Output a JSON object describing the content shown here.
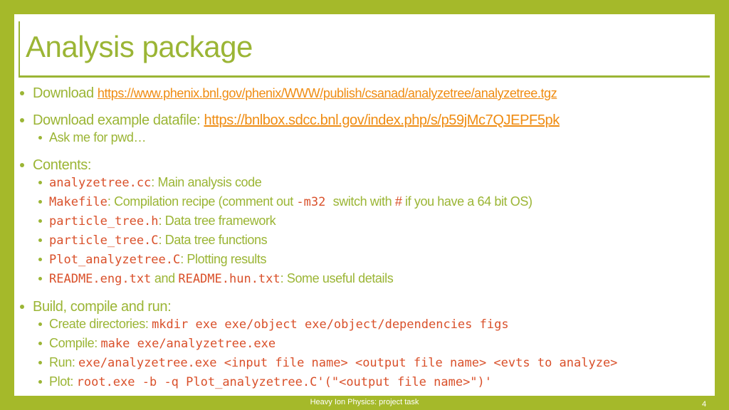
{
  "title": "Analysis package",
  "colors": {
    "frame": "#a5b92a",
    "text": "#9bb535",
    "code": "#d9502a",
    "link": "#ef8c12"
  },
  "lines": [
    {
      "level": 1,
      "top": 0,
      "segments": [
        {
          "t": "Download ",
          "k": "text"
        },
        {
          "t": "https://www.phenix.bnl.gov/phenix/WWW/publish/csanad/analyzetree/analyzetree.tgz",
          "k": "link small"
        }
      ]
    },
    {
      "level": 1,
      "segments": [
        {
          "t": "Download example datafile: ",
          "k": "text"
        },
        {
          "t": "https://bnlbox.sdcc.bnl.gov/index.php/s/p59jMc7QJEPF5pk",
          "k": "link"
        }
      ]
    },
    {
      "level": 2,
      "segments": [
        {
          "t": "Ask me for pwd…",
          "k": "text"
        }
      ]
    },
    {
      "level": 1,
      "segments": [
        {
          "t": "Contents:",
          "k": "text"
        }
      ]
    },
    {
      "level": 2,
      "segments": [
        {
          "t": "analyzetree.cc",
          "k": "code"
        },
        {
          "t": ": Main analysis code",
          "k": "text"
        }
      ]
    },
    {
      "level": 2,
      "segments": [
        {
          "t": "Makefile",
          "k": "code"
        },
        {
          "t": ": Compilation recipe (comment out ",
          "k": "text"
        },
        {
          "t": "-m32 ",
          "k": "code"
        },
        {
          "t": " switch with ",
          "k": "text"
        },
        {
          "t": "#",
          "k": "sym"
        },
        {
          "t": " if you have a 64 bit OS)",
          "k": "text"
        }
      ]
    },
    {
      "level": 2,
      "segments": [
        {
          "t": "particle_tree.h",
          "k": "code"
        },
        {
          "t": ": Data tree framework",
          "k": "text"
        }
      ]
    },
    {
      "level": 2,
      "segments": [
        {
          "t": "particle_tree.C",
          "k": "code"
        },
        {
          "t": ": Data tree functions",
          "k": "text"
        }
      ]
    },
    {
      "level": 2,
      "segments": [
        {
          "t": "Plot_analyzetree.C",
          "k": "code"
        },
        {
          "t": ": Plotting results",
          "k": "text"
        }
      ]
    },
    {
      "level": 2,
      "segments": [
        {
          "t": "README.eng.txt",
          "k": "code"
        },
        {
          "t": " and ",
          "k": "text"
        },
        {
          "t": "README.hun.txt",
          "k": "code"
        },
        {
          "t": ": Some useful details",
          "k": "text"
        }
      ]
    },
    {
      "level": 1,
      "segments": [
        {
          "t": "Build, compile and run:",
          "k": "text"
        }
      ]
    },
    {
      "level": 2,
      "segments": [
        {
          "t": "Create directories: ",
          "k": "text"
        },
        {
          "t": "mkdir exe exe/object exe/object/dependencies figs",
          "k": "code"
        }
      ]
    },
    {
      "level": 2,
      "segments": [
        {
          "t": "Compile: ",
          "k": "text"
        },
        {
          "t": "make exe/analyzetree.exe",
          "k": "code"
        }
      ]
    },
    {
      "level": 2,
      "segments": [
        {
          "t": "Run: ",
          "k": "text"
        },
        {
          "t": "exe/analyzetree.exe <input file name> <output file name> <evts to analyze>",
          "k": "code"
        }
      ]
    },
    {
      "level": 2,
      "segments": [
        {
          "t": "Plot: ",
          "k": "text"
        },
        {
          "t": "root.exe -b -q Plot_analyzetree.C'(\"<output file name>\")'",
          "k": "code"
        }
      ]
    }
  ],
  "footer": "Heavy Ion Physics: project task",
  "page_number": "4"
}
